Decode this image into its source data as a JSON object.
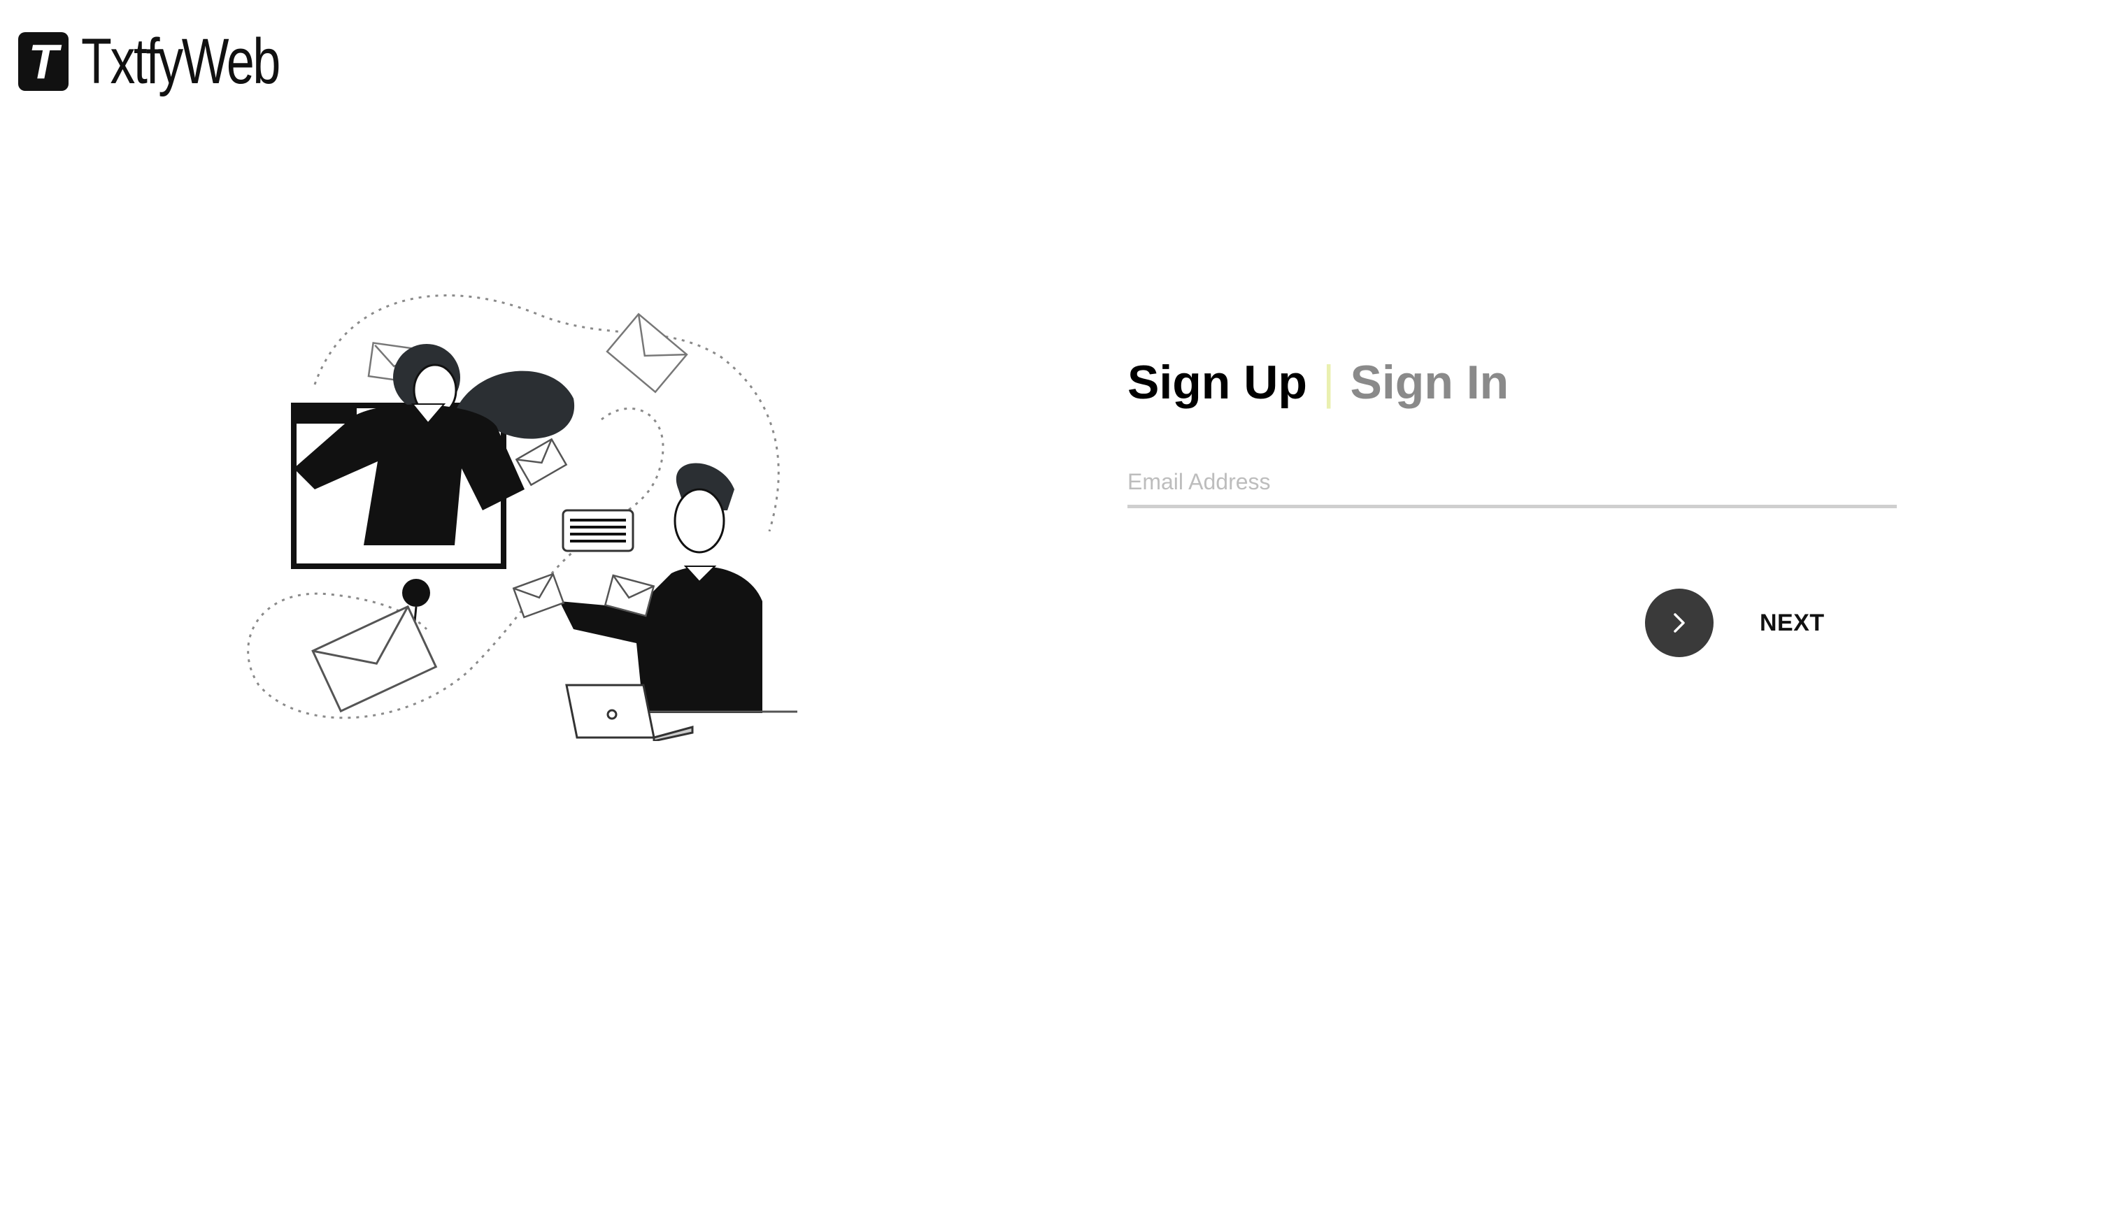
{
  "brand": {
    "logo_letter": "T",
    "name": "TxtfyWeb"
  },
  "auth": {
    "tab_signup": "Sign Up",
    "separator": "|",
    "tab_signin": "Sign In",
    "active_tab": "Sign Up",
    "email": {
      "placeholder": "Email Address",
      "value": ""
    },
    "next_label": "NEXT",
    "next_icon": "chevron-right-icon"
  },
  "colors": {
    "active_tab": "#000000",
    "inactive_tab": "#8a8a8a",
    "separator": "#eaf0b0",
    "next_button": "#3a3a3a"
  }
}
